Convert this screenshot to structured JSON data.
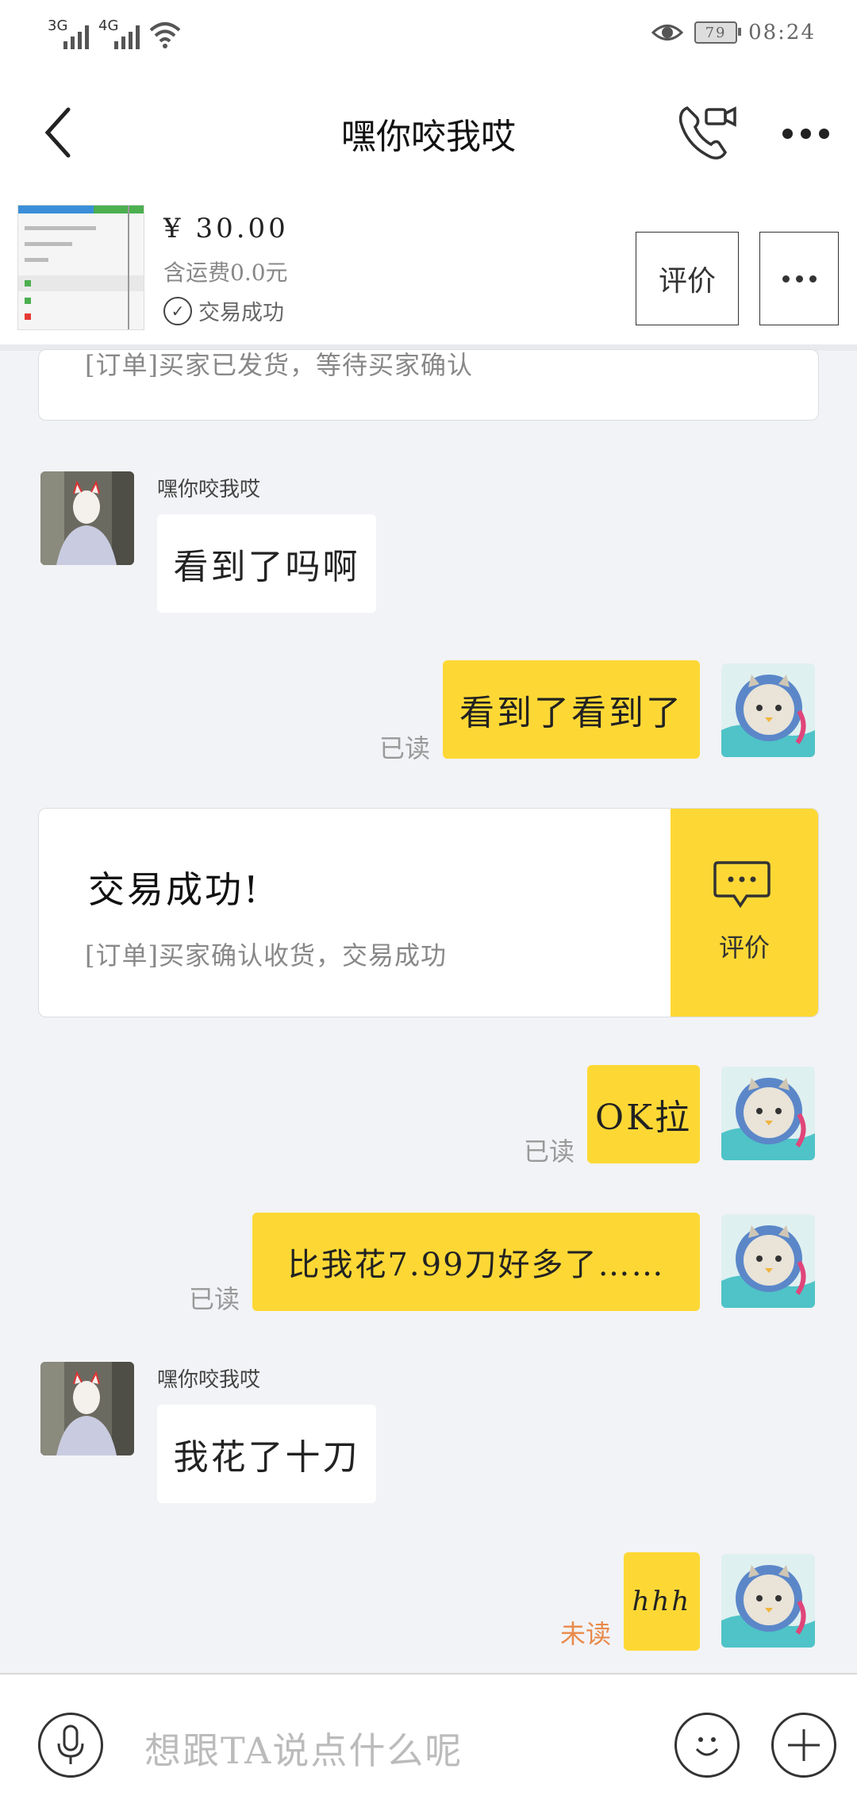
{
  "status_bar": {
    "net1": "3G",
    "net2": "4G",
    "battery": "79",
    "time": "08:24"
  },
  "header": {
    "title": "嘿你咬我哎"
  },
  "product": {
    "price": "¥ 30.00",
    "shipping": "含运费0.0元",
    "deal_status": "交易成功",
    "review_button": "评价"
  },
  "top_card": {
    "text": "[订单]买家已发货，等待买家确认"
  },
  "messages": [
    {
      "sender": "嘿你咬我哎",
      "text": "看到了吗啊"
    },
    {
      "text": "看到了看到了",
      "status": "已读"
    },
    {
      "text": "OK拉",
      "status": "已读"
    },
    {
      "text": "比我花7.99刀好多了……",
      "status": "已读"
    },
    {
      "sender": "嘿你咬我哎",
      "text": "我花了十刀"
    },
    {
      "text": "hhh",
      "status": "未读"
    }
  ],
  "deal_card": {
    "title": "交易成功!",
    "subtitle": "[订单]买家确认收货，交易成功",
    "action_label": "评价"
  },
  "input": {
    "placeholder": "想跟TA说点什么呢"
  },
  "colors": {
    "accent_yellow": "#fdd835",
    "unread_orange": "#e98a4a",
    "bg": "#f2f3f6"
  }
}
